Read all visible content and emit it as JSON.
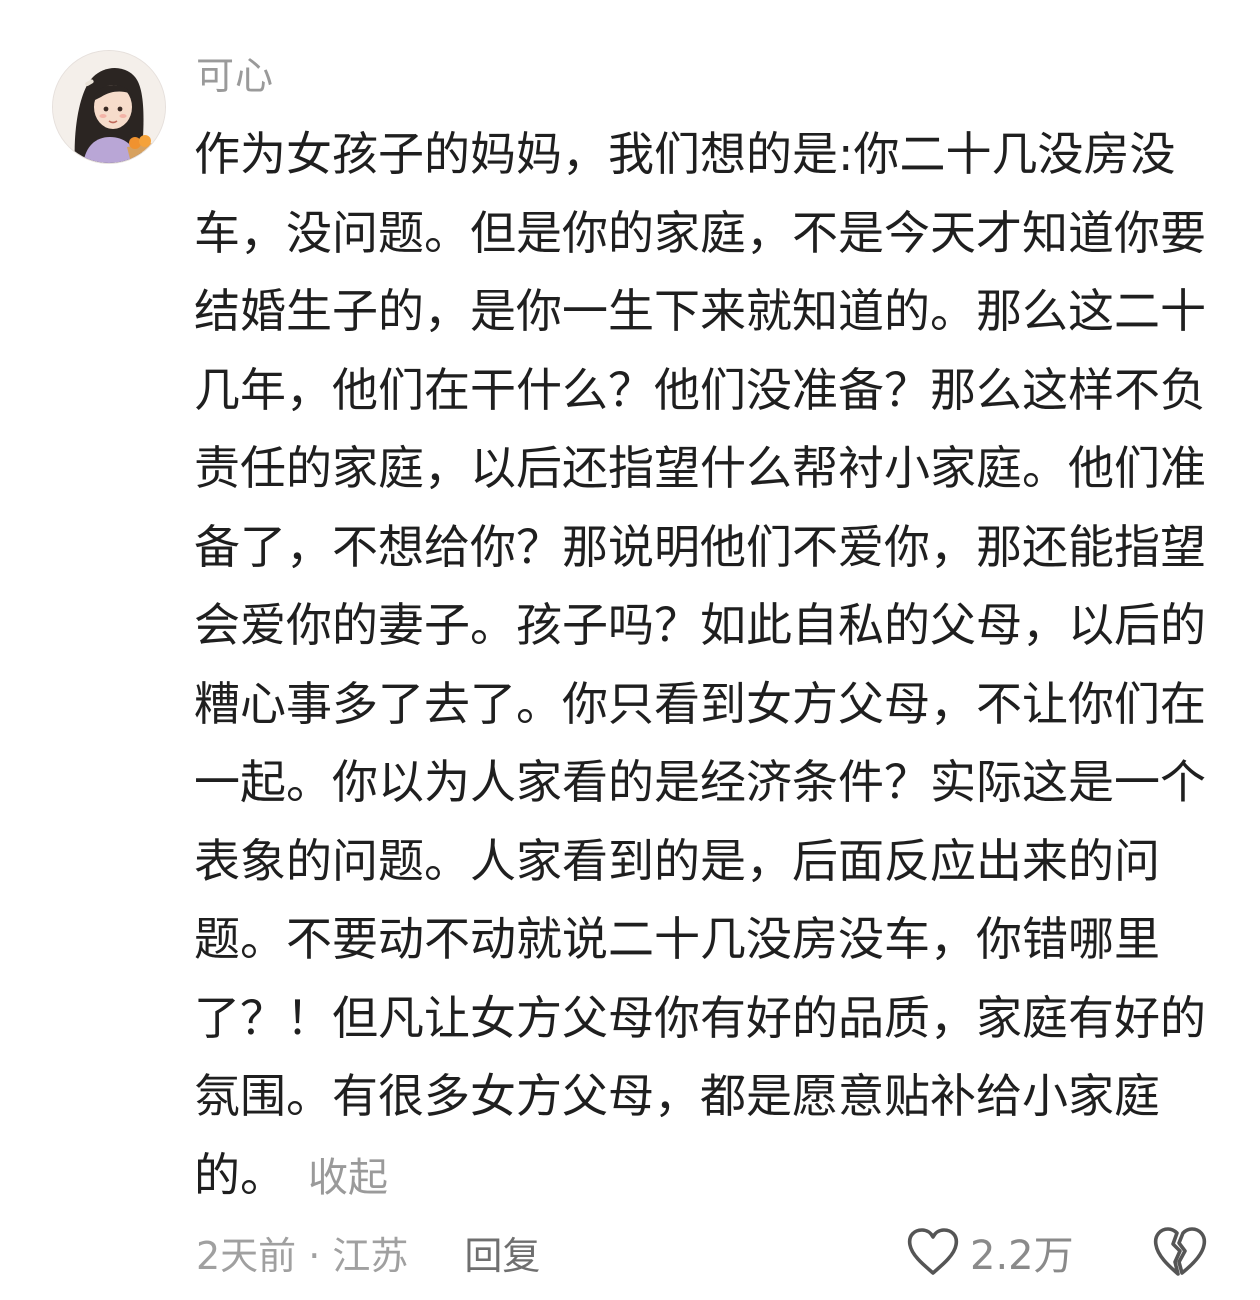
{
  "comment": {
    "username": "可心",
    "body": "作为女孩子的妈妈，我们想的是:你二十几没房没车，没问题。但是你的家庭，不是今天才知道你要结婚生子的，是你一生下来就知道的。那么这二十几年，他们在干什么？他们没准备？那么这样不负责任的家庭，以后还指望什么帮衬小家庭。他们准备了，不想给你？那说明他们不爱你，那还能指望会爱你的妻子。孩子吗？如此自私的父母，以后的糟心事多了去了。你只看到女方父母，不让你们在一起。你以为人家看的是经济条件？实际这是一个表象的问题。人家看到的是，后面反应出来的问题。不要动不动就说二十几没房没车，你错哪里了？！但凡让女方父母你有好的品质，家庭有好的氛围。有很多女方父母，都是愿意贴补给小家庭的。",
    "collapse_label": "收起",
    "time_location": "2天前 · 江苏",
    "reply_label": "回复",
    "like_count": "2.2万",
    "icons": {
      "like": "heart-outline-icon",
      "dislike": "broken-heart-icon",
      "avatar": "avatar-illustration"
    },
    "colors": {
      "text": "#1f1f1f",
      "muted": "#9a9a9a",
      "icon": "#555555"
    }
  }
}
